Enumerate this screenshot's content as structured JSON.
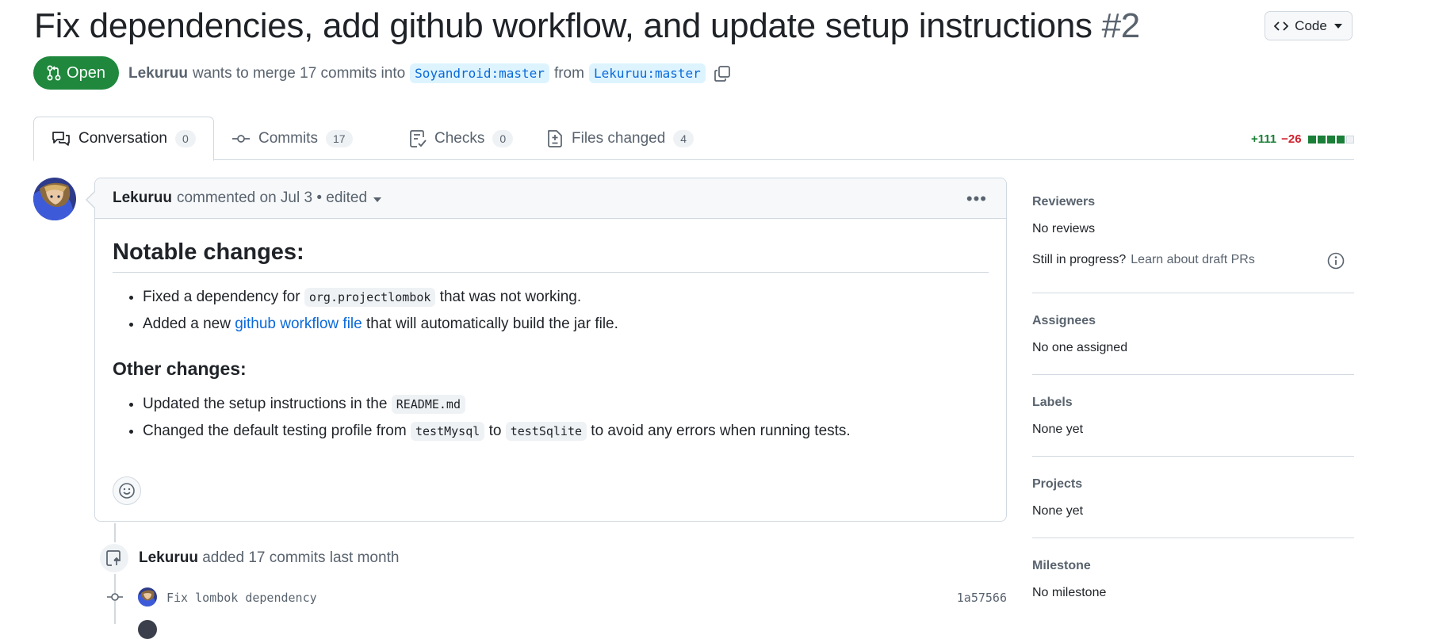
{
  "pr": {
    "title": "Fix dependencies, add github workflow, and update setup instructions",
    "number": "#2",
    "state": "Open",
    "author": "Lekuruu",
    "merge_text": "wants to merge 17 commits into",
    "base_branch": "Soyandroid:master",
    "from_text": "from",
    "head_branch": "Lekuruu:master"
  },
  "code_button": {
    "label": "Code"
  },
  "tabs": [
    {
      "label": "Conversation",
      "count": "0",
      "icon": "comment-discussion-icon"
    },
    {
      "label": "Commits",
      "count": "17",
      "icon": "git-commit-icon"
    },
    {
      "label": "Checks",
      "count": "0",
      "icon": "checklist-icon"
    },
    {
      "label": "Files changed",
      "count": "4",
      "icon": "file-diff-icon"
    }
  ],
  "diffstat": {
    "additions": "+111",
    "deletions": "−26"
  },
  "comment": {
    "author": "Lekuruu",
    "meta": "commented on Jul 3 • edited",
    "h2": "Notable changes:",
    "notable": {
      "item1_pre": "Fixed a dependency for",
      "item1_code": "org.projectlombok",
      "item1_post": "that was not working.",
      "item2_pre": "Added a new",
      "item2_link": "github workflow file",
      "item2_post": "that will automatically build the jar file."
    },
    "h3": "Other changes:",
    "other": {
      "item1_pre": "Updated the setup instructions in the",
      "item1_code": "README.md",
      "item2_pre": "Changed the default testing profile from",
      "item2_code1": "testMysql",
      "item2_mid": "to",
      "item2_code2": "testSqlite",
      "item2_post": "to avoid any errors when running tests."
    }
  },
  "timeline": {
    "author": "Lekuruu",
    "event": "added 17 commits last month",
    "commits": [
      {
        "message": "Fix lombok dependency",
        "sha": "1a57566"
      }
    ]
  },
  "sidebar": {
    "reviewers": {
      "label": "Reviewers",
      "value": "No reviews",
      "draft_q": "Still in progress?",
      "draft_link": "Learn about draft PRs"
    },
    "assignees": {
      "label": "Assignees",
      "value": "No one assigned"
    },
    "labels": {
      "label": "Labels",
      "value": "None yet"
    },
    "projects": {
      "label": "Projects",
      "value": "None yet"
    },
    "milestone": {
      "label": "Milestone",
      "value": "No milestone"
    }
  },
  "colors": {
    "open_green": "#1f883d",
    "link_blue": "#0969da",
    "add_green": "#1a7f37",
    "del_red": "#cf222e",
    "border": "#d1d9e0"
  }
}
